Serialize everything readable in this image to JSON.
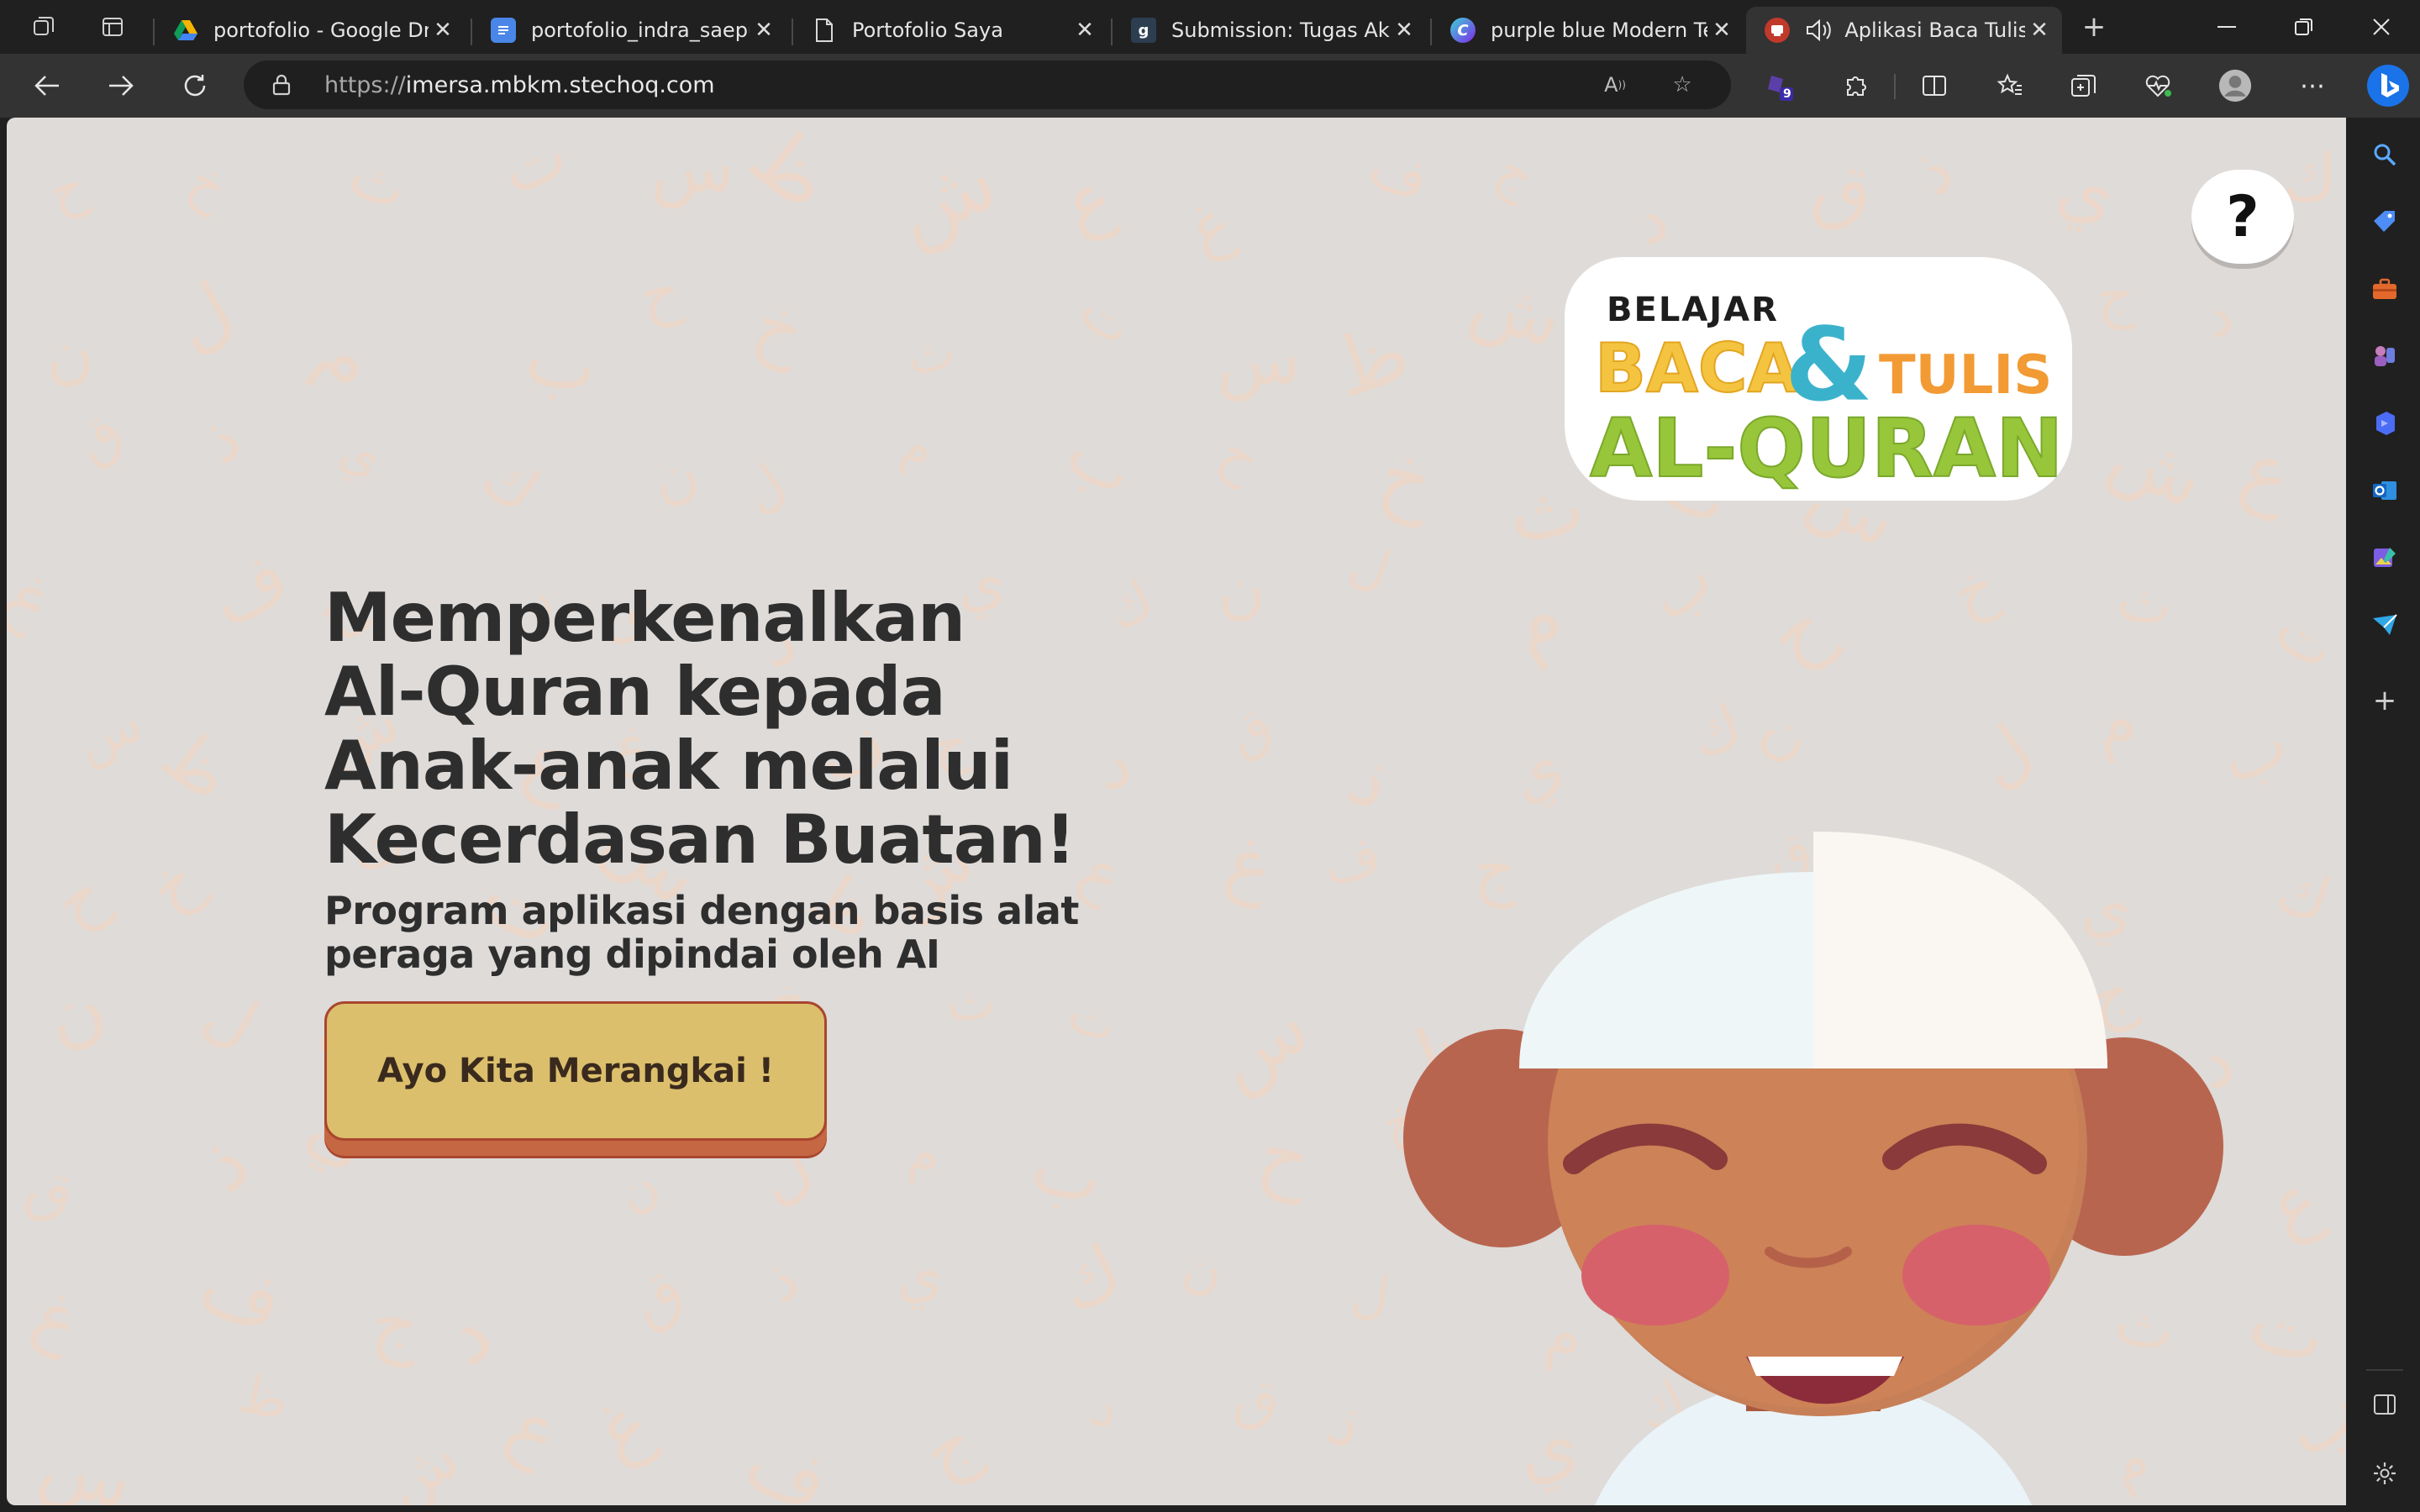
{
  "browser": {
    "tabs": [
      {
        "title": "portofolio - Google Drive",
        "favicon": "google-drive-icon",
        "active": false
      },
      {
        "title": "portofolio_indra_saepudin",
        "favicon": "google-docs-icon",
        "active": false
      },
      {
        "title": "Portofolio Saya",
        "favicon": "page-icon",
        "active": false
      },
      {
        "title": "Submission: Tugas Akhir",
        "favicon": "g-icon",
        "active": false
      },
      {
        "title": "purple blue Modern Tech",
        "favicon": "canva-icon",
        "active": false
      },
      {
        "title": "Aplikasi Baca Tulis",
        "favicon": "app-icon",
        "active": true,
        "audio": true
      }
    ],
    "url_protocol": "https://",
    "url_host": "imersa.mbkm.stechoq.com",
    "extension_badge": "9"
  },
  "page": {
    "help_label": "?",
    "logo": {
      "line1": "BELAJAR",
      "word_baca": "BACA",
      "ampersand": "&",
      "word_tulis": "TULIS",
      "line3": "AL-QURAN"
    },
    "headline": "Memperkenalkan Al-Quran kepada Anak-anak melalui Kecerdasan Buatan!",
    "subheadline": "Program aplikasi dengan basis alat peraga yang dipindai oleh AI",
    "cta_label": "Ayo Kita Merangkai !",
    "background_letters": [
      "ح",
      "خ",
      "ث",
      "ت",
      "س",
      "ظ",
      "ش",
      "ع",
      "غ",
      "ف",
      "ج",
      "د",
      "ق",
      "ذ",
      "ي",
      "ك",
      "ن",
      "ل",
      "م",
      "ب"
    ]
  },
  "colors": {
    "page_bg": "#dedbd9",
    "text_dark": "#2e2e2e",
    "cta_bg": "#dcbf6c",
    "cta_shadow": "#c56743",
    "logo_yellow": "#f4c441",
    "logo_blue": "#3bb2cc",
    "logo_orange": "#f29a33",
    "logo_green": "#97c63b"
  }
}
